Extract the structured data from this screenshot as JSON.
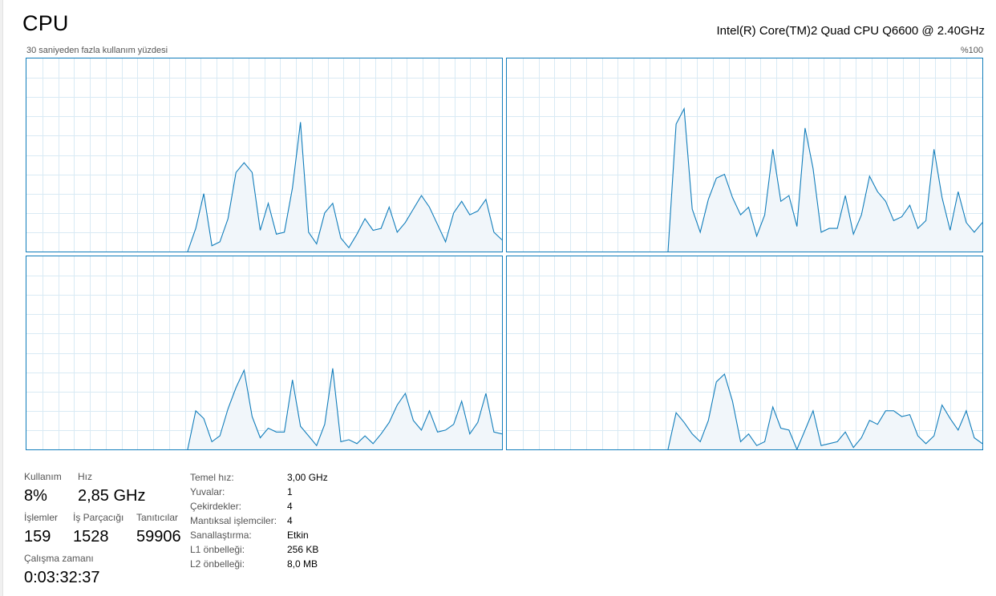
{
  "header": {
    "title": "CPU",
    "cpu_name": "Intel(R) Core(TM)2 Quad CPU Q6600 @ 2.40GHz",
    "graph_caption": "30 saniyeden fazla kullanım yüzdesi",
    "max_label": "%100"
  },
  "colors": {
    "line": "#117dbb",
    "fill": "#f1f6fa",
    "grid": "#d9eaf4",
    "border": "#117dbb"
  },
  "chart_data": {
    "type": "area",
    "ylim": [
      0,
      100
    ],
    "grid": true,
    "cores": [
      {
        "values": [
          0,
          0,
          0,
          0,
          0,
          0,
          0,
          0,
          0,
          0,
          0,
          0,
          0,
          0,
          0,
          0,
          0,
          0,
          0,
          0,
          0,
          12,
          30,
          3,
          5,
          17,
          41,
          46,
          41,
          11,
          25,
          9,
          10,
          33,
          67,
          10,
          4,
          20,
          25,
          7,
          2,
          9,
          17,
          11,
          12,
          23,
          10,
          15,
          22,
          29,
          23,
          14,
          5,
          20,
          26,
          19,
          21,
          27,
          10,
          6
        ]
      },
      {
        "values": [
          0,
          0,
          0,
          0,
          0,
          0,
          0,
          0,
          0,
          0,
          0,
          0,
          0,
          0,
          0,
          0,
          0,
          0,
          0,
          0,
          0,
          66,
          74,
          22,
          10,
          27,
          38,
          40,
          28,
          19,
          23,
          8,
          19,
          53,
          26,
          29,
          13,
          64,
          43,
          10,
          12,
          12,
          29,
          9,
          19,
          39,
          31,
          26,
          16,
          18,
          24,
          12,
          16,
          53,
          28,
          11,
          31,
          15,
          10,
          15
        ]
      },
      {
        "values": [
          0,
          0,
          0,
          0,
          0,
          0,
          0,
          0,
          0,
          0,
          0,
          0,
          0,
          0,
          0,
          0,
          0,
          0,
          0,
          0,
          0,
          20,
          16,
          4,
          7,
          21,
          32,
          41,
          17,
          6,
          11,
          9,
          9,
          36,
          12,
          7,
          2,
          13,
          42,
          4,
          5,
          3,
          7,
          3,
          8,
          14,
          23,
          29,
          15,
          10,
          20,
          9,
          10,
          13,
          25,
          8,
          14,
          29,
          9,
          8
        ]
      },
      {
        "values": [
          0,
          0,
          0,
          0,
          0,
          0,
          0,
          0,
          0,
          0,
          0,
          0,
          0,
          0,
          0,
          0,
          0,
          0,
          0,
          0,
          0,
          19,
          14,
          8,
          4,
          15,
          35,
          39,
          25,
          4,
          8,
          2,
          4,
          22,
          11,
          10,
          0,
          10,
          20,
          2,
          3,
          4,
          9,
          1,
          6,
          15,
          13,
          20,
          20,
          17,
          18,
          7,
          3,
          7,
          23,
          16,
          10,
          20,
          6,
          3
        ]
      }
    ]
  },
  "stats": {
    "usage": {
      "label": "Kullanım",
      "value": "8%"
    },
    "speed": {
      "label": "Hız",
      "value": "2,85 GHz"
    },
    "processes": {
      "label": "İşlemler",
      "value": "159"
    },
    "threads": {
      "label": "İş Parçacığı",
      "value": "1528"
    },
    "handles": {
      "label": "Tanıtıcılar",
      "value": "59906"
    },
    "uptime": {
      "label": "Çalışma zamanı",
      "value": "0:03:32:37"
    }
  },
  "specs": [
    {
      "key": "Temel hız:",
      "value": "3,00 GHz"
    },
    {
      "key": "Yuvalar:",
      "value": "1"
    },
    {
      "key": "Çekirdekler:",
      "value": "4"
    },
    {
      "key": "Mantıksal işlemciler:",
      "value": "4"
    },
    {
      "key": "Sanallaştırma:",
      "value": "Etkin"
    },
    {
      "key": "L1 önbelleği:",
      "value": "256 KB"
    },
    {
      "key": "L2 önbelleği:",
      "value": "8,0 MB"
    }
  ]
}
